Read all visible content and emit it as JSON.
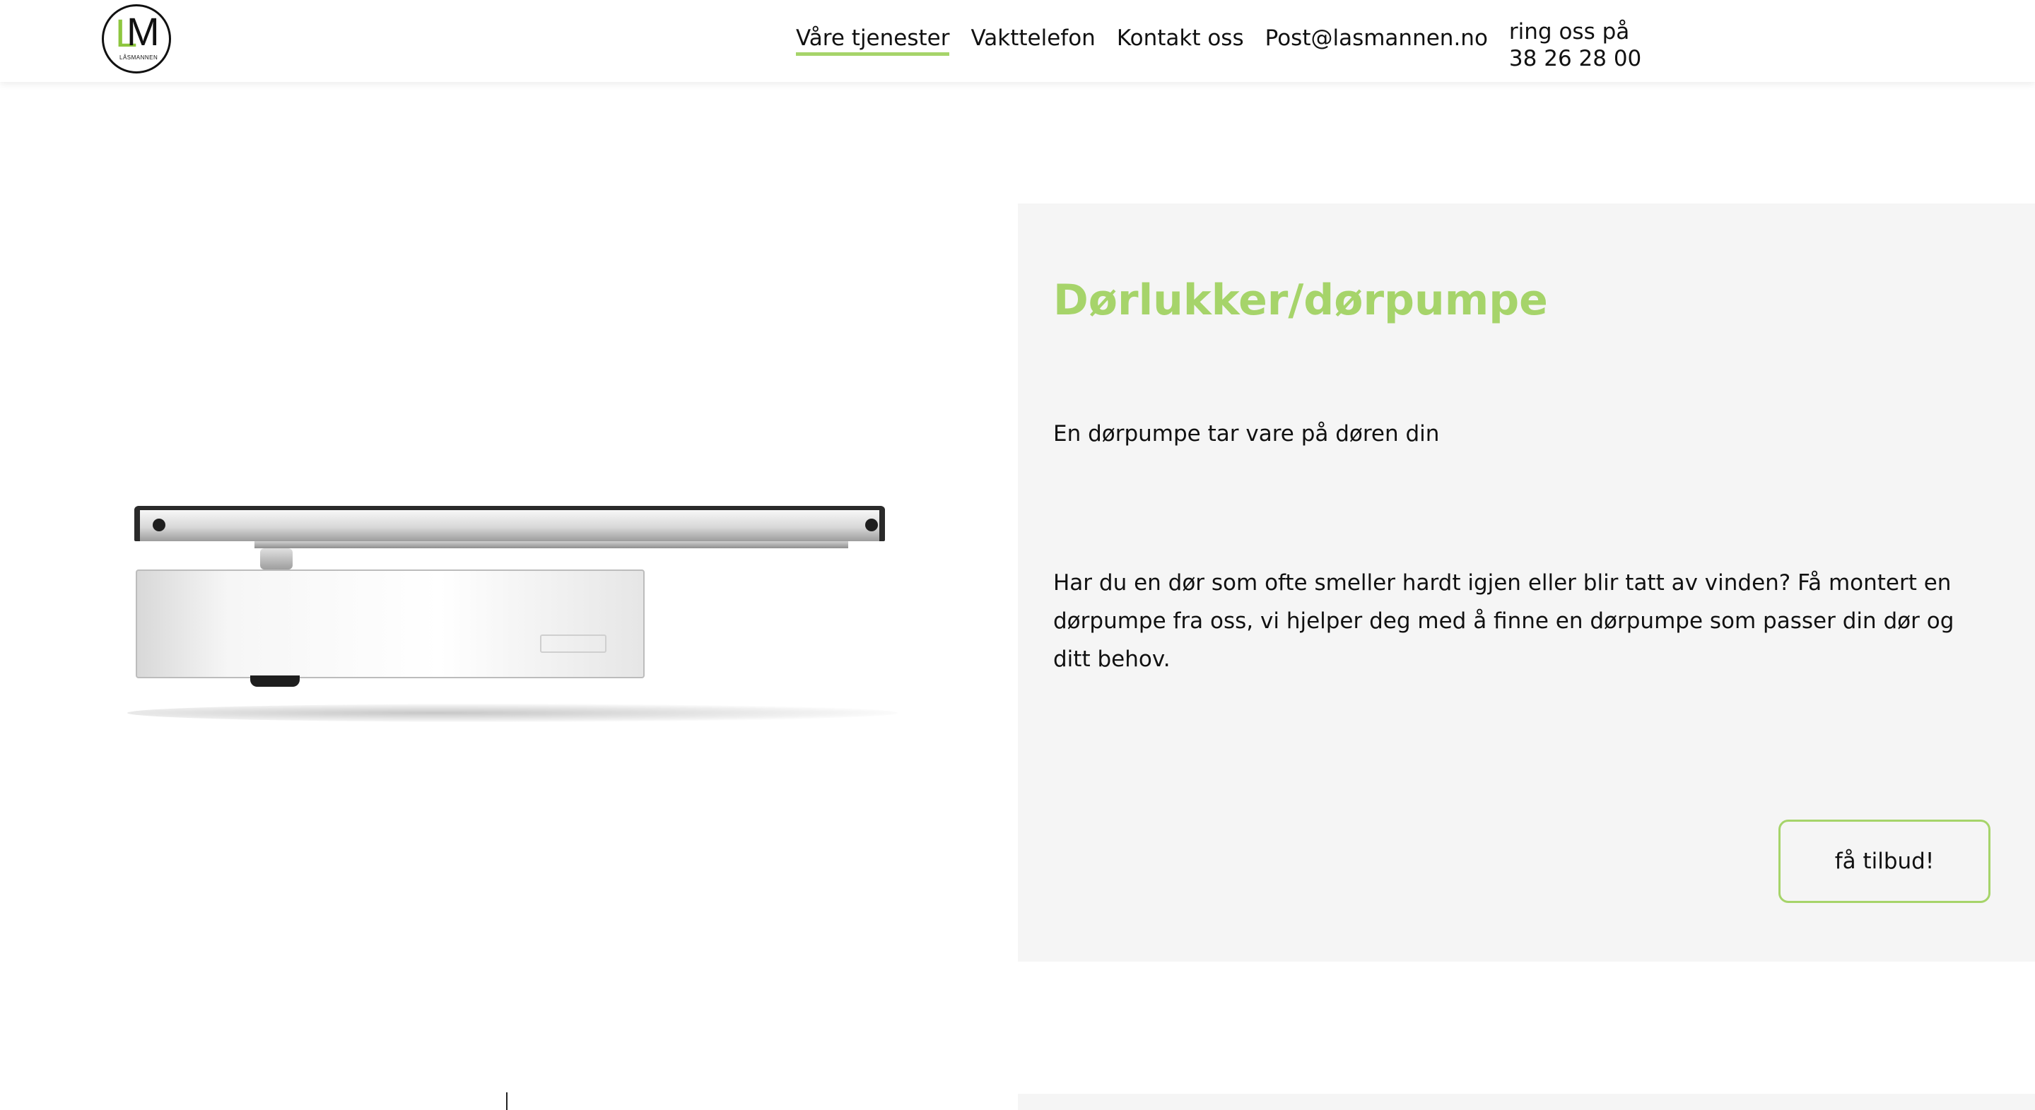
{
  "logo": {
    "letter_l": "L",
    "letter_m": "M",
    "subtext": "LÅSMANNEN"
  },
  "nav": {
    "items": [
      {
        "label": "Våre tjenester",
        "active": true
      },
      {
        "label": "Vakttelefon",
        "active": false
      },
      {
        "label": "Kontakt oss",
        "active": false
      },
      {
        "label": "Post@lasmannen.no",
        "active": false
      }
    ],
    "phone_line1": "ring oss på",
    "phone_line2": "38 26 28 00"
  },
  "product": {
    "image": "door-closer-image"
  },
  "panel": {
    "title": "Dørlukker/dørpumpe",
    "intro": "En dørpumpe tar vare på døren din",
    "body": "Har du en dør som ofte smeller hardt igjen eller blir tatt av vinden? Få montert en dørpumpe fra oss, vi hjelper deg med å finne en dørpumpe som passer din dør og ditt behov.",
    "cta_label": "få tilbud!"
  },
  "colors": {
    "accent": "#a6d46a",
    "panel_bg": "#f5f5f5",
    "text": "#111111"
  }
}
